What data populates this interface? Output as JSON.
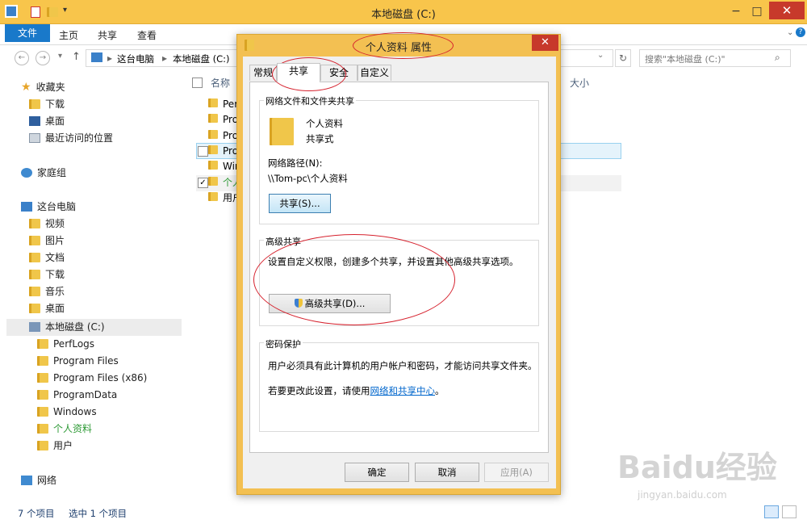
{
  "window": {
    "title": "本地磁盘 (C:)"
  },
  "ribbon": {
    "tabs": [
      "文件",
      "主页",
      "共享",
      "查看"
    ]
  },
  "address": {
    "crumbs": [
      "这台电脑",
      "本地磁盘 (C:)"
    ],
    "separator": "▸"
  },
  "search": {
    "placeholder": "搜索\"本地磁盘 (C:)\""
  },
  "sidebar": {
    "favorites": "收藏夹",
    "fav_items": [
      "下载",
      "桌面",
      "最近访问的位置"
    ],
    "homegroup": "家庭组",
    "thispc": "这台电脑",
    "pc_items": [
      "视频",
      "图片",
      "文档",
      "下载",
      "音乐",
      "桌面"
    ],
    "drive": "本地磁盘 (C:)",
    "drive_items": [
      "PerfLogs",
      "Program Files",
      "Program Files (x86)",
      "ProgramData",
      "Windows",
      "个人资料",
      "用户"
    ],
    "network": "网络"
  },
  "list": {
    "col_name": "名称",
    "col_size": "大小",
    "rows": [
      "Perf",
      "Pro",
      "Pro",
      "Pro",
      "Win",
      "个人",
      "用户"
    ]
  },
  "status": {
    "count": "7 个项目",
    "selected": "选中 1 个项目"
  },
  "dialog": {
    "title": "个人资料 属性",
    "tabs": [
      "常规",
      "共享",
      "安全",
      "自定义"
    ],
    "net_group": "网络文件和文件夹共享",
    "folder_name": "个人资料",
    "folder_state": "共享式",
    "path_label": "网络路径(N):",
    "path_value": "\\\\Tom-pc\\个人资料",
    "share_btn": "共享(S)...",
    "adv_group": "高级共享",
    "adv_desc": "设置自定义权限，创建多个共享，并设置其他高级共享选项。",
    "adv_btn": "高级共享(D)...",
    "pwd_group": "密码保护",
    "pwd_desc": "用户必须具有此计算机的用户帐户和密码，才能访问共享文件夹。",
    "pwd_change_prefix": "若要更改此设置，请使用",
    "pwd_link": "网络和共享中心",
    "pwd_suffix": "。",
    "ok": "确定",
    "cancel": "取消",
    "apply": "应用(A)"
  },
  "watermark": {
    "brand": "Baidu经验",
    "url": "jingyan.baidu.com"
  },
  "colors": {
    "titlebar": "#f8c54b",
    "accent": "#1979ca",
    "close": "#c7392b",
    "annotation": "#d6222e"
  }
}
